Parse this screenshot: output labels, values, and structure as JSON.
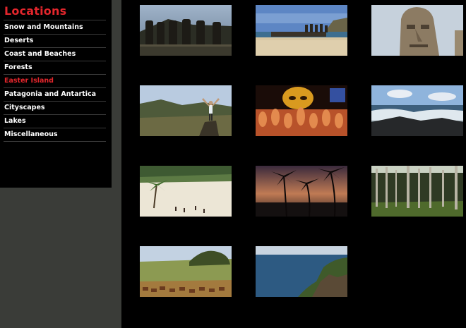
{
  "sidebar": {
    "title": "Locations",
    "items": [
      {
        "label": "Snow and Mountains",
        "active": false
      },
      {
        "label": "Deserts",
        "active": false
      },
      {
        "label": "Coast and Beaches",
        "active": false
      },
      {
        "label": "Forests",
        "active": false
      },
      {
        "label": "Easter Island",
        "active": true
      },
      {
        "label": "Patagonia and Antartica",
        "active": false
      },
      {
        "label": "Cityscapes",
        "active": false
      },
      {
        "label": "Lakes",
        "active": false
      },
      {
        "label": "Miscellaneous",
        "active": false
      }
    ]
  },
  "gallery": {
    "thumbnails": [
      {
        "subject": "moai-row-silhouette"
      },
      {
        "subject": "ahu-platform-beach"
      },
      {
        "subject": "moai-head-closeup"
      },
      {
        "subject": "hiker-arms-raised-crater"
      },
      {
        "subject": "festival-dancers-night"
      },
      {
        "subject": "rocky-coast-waves"
      },
      {
        "subject": "palm-beach-anakena"
      },
      {
        "subject": "palm-silhouettes-sunset"
      },
      {
        "subject": "palm-grove-forest"
      },
      {
        "subject": "horses-grassland"
      },
      {
        "subject": "sea-cliff-ocean"
      }
    ]
  },
  "colors": {
    "accent": "#e3262c",
    "sidebar_bg": "#000000",
    "gutter_bg": "#3a3c38",
    "content_bg": "#000000",
    "menu_text": "#ffffff"
  }
}
